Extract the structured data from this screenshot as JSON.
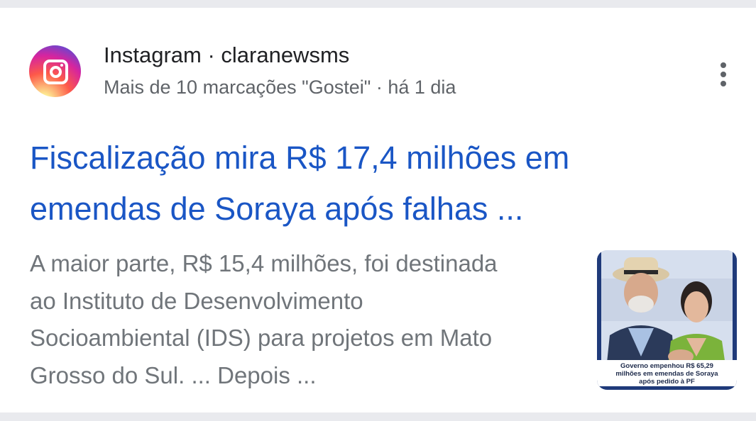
{
  "result": {
    "source": "Instagram · claranewsms",
    "meta": "Mais de 10 marcações \"Gostei\" · há 1 dia",
    "title_line1": "Fiscalização mira R$ 17,4 milhões em",
    "title_line2": "emendas de Soraya após falhas ...",
    "snippet_line1": "A maior parte, R$ 15,4 milhões, foi destinada",
    "snippet_line2": "ao Instituto de Desenvolvimento",
    "snippet_line3": "Socioambiental (IDS) para projetos em Mato",
    "snippet_line4": "Grosso do Sul. ... Depois ...",
    "thumbnail_caption_line1": "Governo empenhou R$ 65,29",
    "thumbnail_caption_line2": "milhões em emendas de Soraya",
    "thumbnail_caption_line3": "após pedido à PF",
    "source_icon": "instagram-icon",
    "menu_icon": "more-vert-icon"
  },
  "colors": {
    "title": "#1a56c5",
    "snippet": "#70757a",
    "meta": "#5f6368",
    "background": "#e9eaee"
  }
}
